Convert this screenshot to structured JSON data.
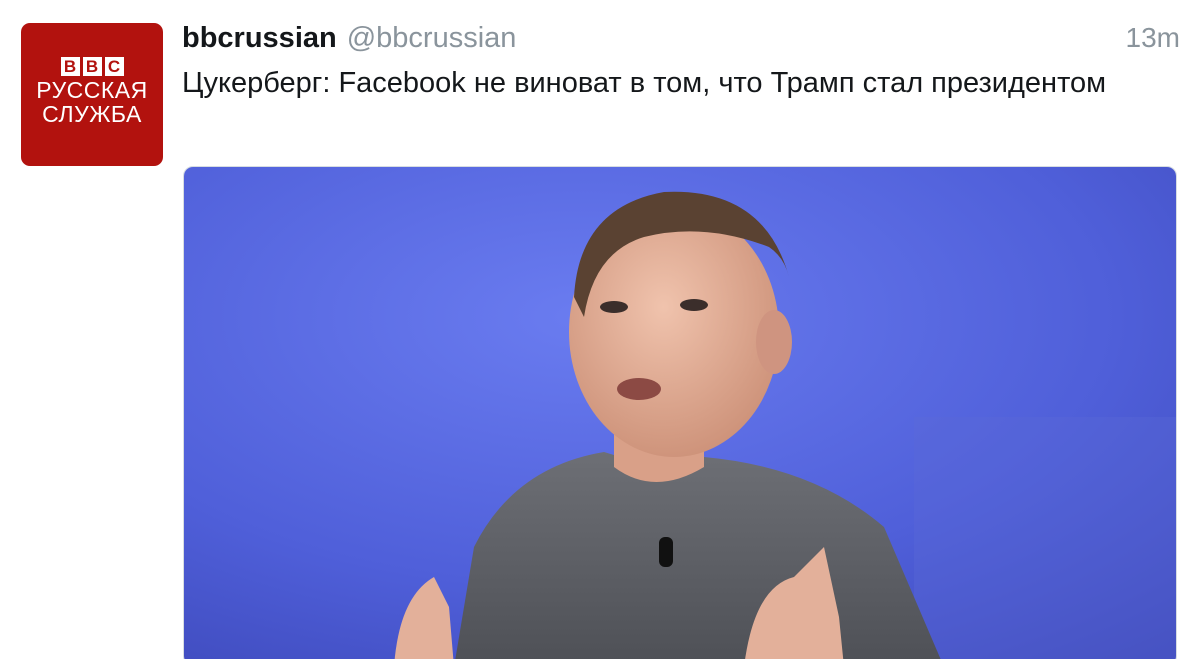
{
  "account": {
    "display_name": "bbcrussian",
    "handle": "@bbcrussian",
    "avatar": {
      "bbc_letters": [
        "B",
        "B",
        "C"
      ],
      "line1": "РУССКАЯ",
      "line2": "СЛУЖБА",
      "color": "#b2120e"
    }
  },
  "tweet": {
    "time": "13m",
    "text": "Цукерберг: Facebook не виноват в том, что Трамп стал президентом"
  },
  "media": {
    "subject": "photo of man in grey t-shirt speaking against blue background",
    "background_color": "#5f6fe0"
  }
}
